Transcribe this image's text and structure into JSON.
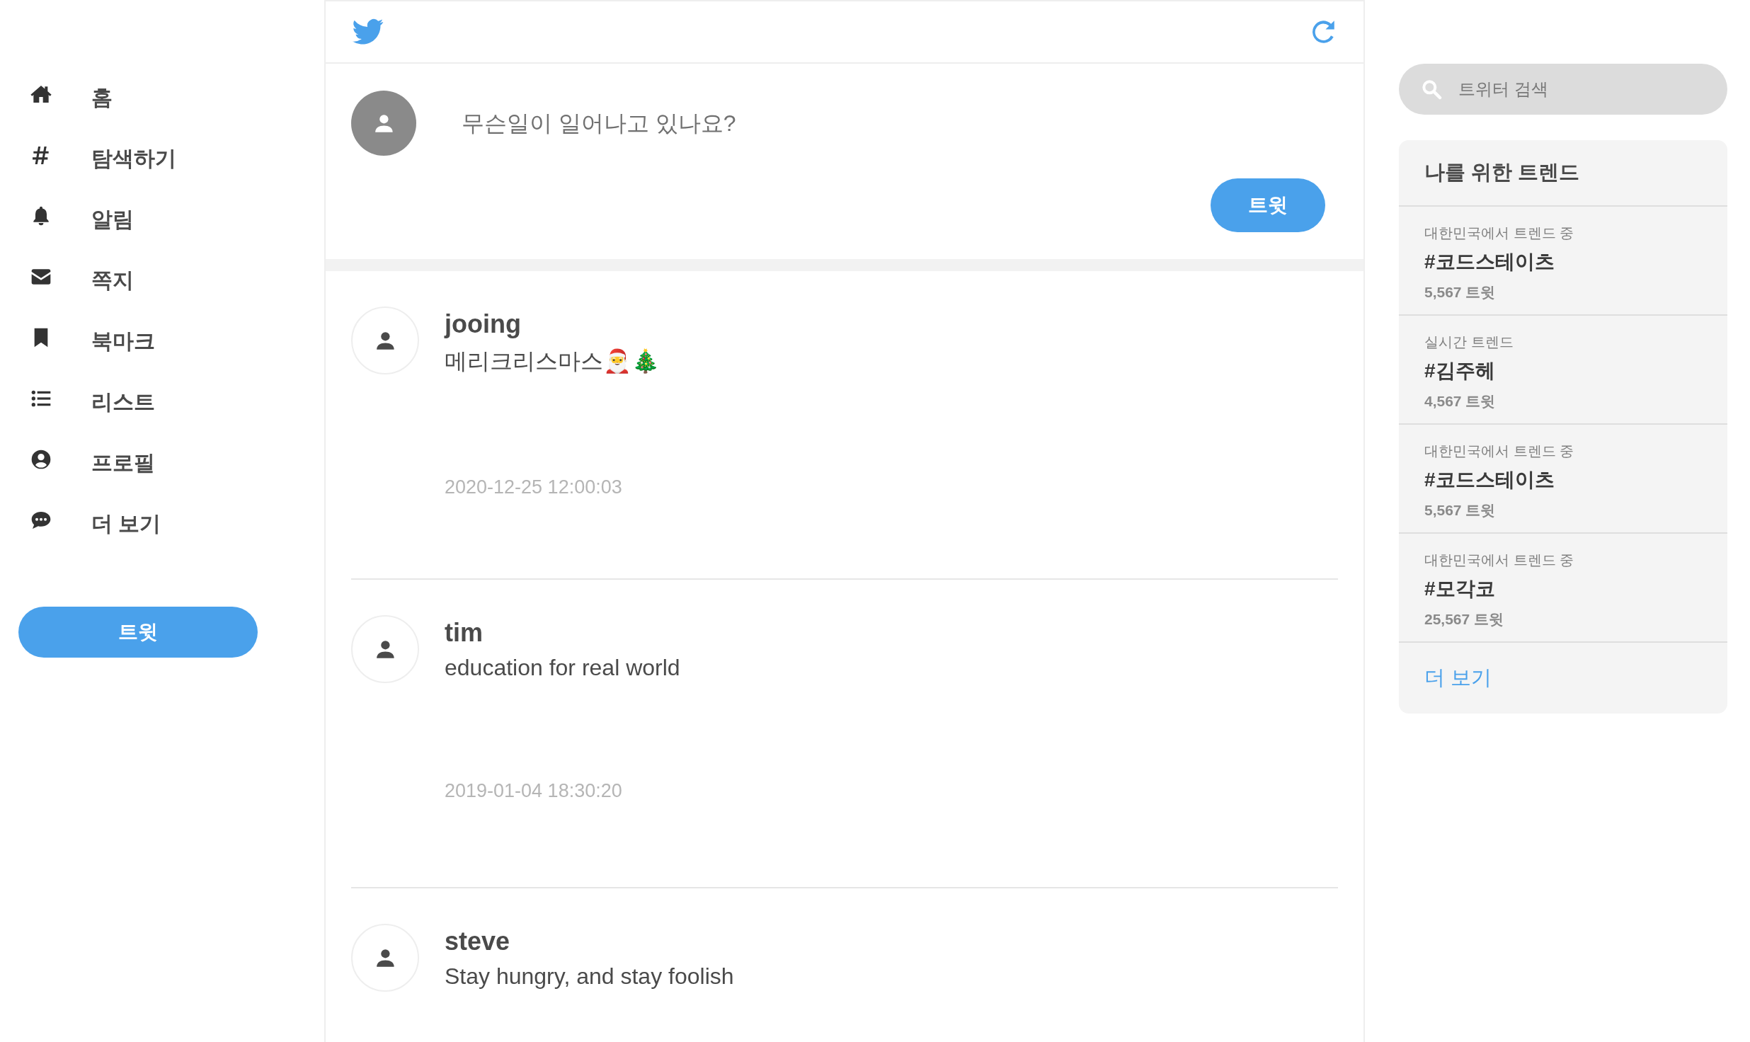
{
  "nav": [
    {
      "kind": "home",
      "label": "홈"
    },
    {
      "kind": "hash",
      "label": "탐색하기"
    },
    {
      "kind": "bell",
      "label": "알림"
    },
    {
      "kind": "mail",
      "label": "쪽지"
    },
    {
      "kind": "bookmark",
      "label": "북마크"
    },
    {
      "kind": "list",
      "label": "리스트"
    },
    {
      "kind": "profile",
      "label": "프로필"
    },
    {
      "kind": "more",
      "label": "더 보기"
    }
  ],
  "sidebar_button": "트윗",
  "compose": {
    "placeholder": "무슨일이 일어나고 있나요?",
    "button": "트윗"
  },
  "tweets": [
    {
      "user": "jooing",
      "text": "메리크리스마스🎅🎄",
      "date": "2020-12-25 12:00:03"
    },
    {
      "user": "tim",
      "text": "education for real world",
      "date": "2019-01-04 18:30:20"
    },
    {
      "user": "steve",
      "text": "Stay hungry, and stay foolish"
    }
  ],
  "search": {
    "placeholder": "트위터 검색"
  },
  "trends": {
    "title": "나를 위한 트렌드",
    "items": [
      {
        "context": "대한민국에서 트렌드 중",
        "tag": "#코드스테이츠",
        "count": "5,567 트윗"
      },
      {
        "context": "실시간 트렌드",
        "tag": "#김주헤",
        "count": "4,567 트윗"
      },
      {
        "context": "대한민국에서 트렌드 중",
        "tag": "#코드스테이츠",
        "count": "5,567 트윗"
      },
      {
        "context": "대한민국에서 트렌드 중",
        "tag": "#모각코",
        "count": "25,567 트윗"
      }
    ],
    "more": "더 보기"
  }
}
